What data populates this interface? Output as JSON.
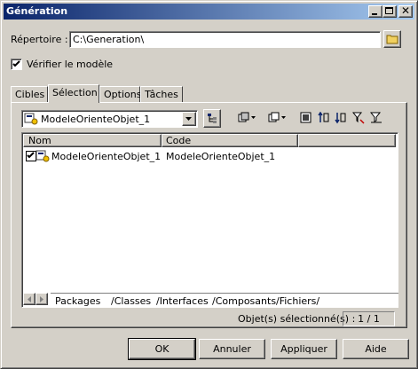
{
  "window": {
    "title": "Génération"
  },
  "directory": {
    "label": "Répertoire :",
    "value": "C:\\Generation\\"
  },
  "verify": {
    "label": "Vérifier le modèle",
    "checked": true
  },
  "tabs": [
    {
      "label": "Cibles"
    },
    {
      "label": "Sélection"
    },
    {
      "label": "Options"
    },
    {
      "label": "Tâches"
    }
  ],
  "model_select": {
    "value": "ModeleOrienteObjet_1"
  },
  "table": {
    "columns": [
      "Nom",
      "Code"
    ],
    "rows": [
      {
        "name": "ModeleOrienteObjet_1",
        "code": "ModeleOrienteObjet_1",
        "checked": true
      }
    ]
  },
  "sub_tabs": [
    {
      "label": "Packages"
    },
    {
      "label": "Classes"
    },
    {
      "label": "Interfaces"
    },
    {
      "label": "Composants"
    },
    {
      "label": "Fichiers"
    }
  ],
  "status": {
    "label": "Objet(s) sélectionné(s) :",
    "count": "1 / 1"
  },
  "buttons": {
    "ok": "OK",
    "cancel": "Annuler",
    "apply": "Appliquer",
    "help": "Aide"
  },
  "icons": {
    "folder": "folder-icon",
    "model": "model-icon",
    "check": "checkmark",
    "accent": "#0a246a"
  }
}
